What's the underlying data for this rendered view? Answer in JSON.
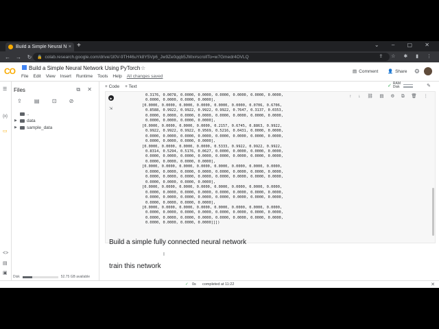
{
  "browser": {
    "tab_title": "Build a Simple Neural Ne",
    "tab_close": "×",
    "new_tab": "+",
    "url": "colab.research.google.com/drive/1l0V-9TH46uYk8Y5Vp6_Jw9Ze0qqb5JWx#scrollTo=w7Gmedr4OVLQ"
  },
  "colab": {
    "notebook_title": "Build a Simple Neural Network Using PyTorch",
    "menu": [
      "File",
      "Edit",
      "View",
      "Insert",
      "Runtime",
      "Tools",
      "Help"
    ],
    "saved_status": "All changes saved",
    "comment_label": "Comment",
    "share_label": "Share"
  },
  "files_panel": {
    "title": "Files",
    "tree": [
      {
        "name": "..",
        "expandable": false
      },
      {
        "name": "data",
        "expandable": true
      },
      {
        "name": "sample_data",
        "expandable": true
      }
    ],
    "disk_label": "Disk",
    "disk_available": "52.75 GB available",
    "disk_used_fraction": 0.28
  },
  "toolbar": {
    "add_code": "+ Code",
    "add_text": "+ Text",
    "ram_label": "RAM",
    "disk_label": "Disk"
  },
  "cell_output": [
    "0.3176, 0.0078, 0.0000, 0.0000, 0.0000, 0.0000, 0.0000, 0.0000,",
    "0.0000, 0.0000, 0.0000, 0.0000],",
    "[0.0000, 0.0000, 0.0000, 0.0000, 0.0000, 0.0000, 0.0706, 0.6706,",
    "0.8588, 0.9922, 0.9922, 0.9922, 0.9922, 0.7647, 0.3137, 0.0353,",
    "0.0000, 0.0000, 0.0000, 0.0000, 0.0000, 0.0000, 0.0000, 0.0000,",
    "0.0000, 0.0000, 0.0000, 0.0000],",
    "[0.0000, 0.0000, 0.0000, 0.0000, 0.2157, 0.6745, 0.8863, 0.9922,",
    "0.9922, 0.9922, 0.9922, 0.9569, 0.5216, 0.0431, 0.0000, 0.0000,",
    "0.0000, 0.0000, 0.0000, 0.0000, 0.0000, 0.0000, 0.0000, 0.0000,",
    "0.0000, 0.0000, 0.0000, 0.0000],",
    "[0.0000, 0.0000, 0.0000, 0.0000, 0.5333, 0.9922, 0.9922, 0.9922,",
    "0.8314, 0.5294, 0.5176, 0.0627, 0.0000, 0.0000, 0.0000, 0.0000,",
    "0.0000, 0.0000, 0.0000, 0.0000, 0.0000, 0.0000, 0.0000, 0.0000,",
    "0.0000, 0.0000, 0.0000, 0.0000],",
    "[0.0000, 0.0000, 0.0000, 0.0000, 0.0000, 0.0000, 0.0000, 0.0000,",
    "0.0000, 0.0000, 0.0000, 0.0000, 0.0000, 0.0000, 0.0000, 0.0000,",
    "0.0000, 0.0000, 0.0000, 0.0000, 0.0000, 0.0000, 0.0000, 0.0000,",
    "0.0000, 0.0000, 0.0000, 0.0000],",
    "[0.0000, 0.0000, 0.0000, 0.0000, 0.0000, 0.0000, 0.0000, 0.0000,",
    "0.0000, 0.0000, 0.0000, 0.0000, 0.0000, 0.0000, 0.0000, 0.0000,",
    "0.0000, 0.0000, 0.0000, 0.0000, 0.0000, 0.0000, 0.0000, 0.0000,",
    "0.0000, 0.0000, 0.0000, 0.0000],",
    "[0.0000, 0.0000, 0.0000, 0.0000, 0.0000, 0.0000, 0.0000, 0.0000,",
    "0.0000, 0.0000, 0.0000, 0.0000, 0.0000, 0.0000, 0.0000, 0.0000,",
    "0.0000, 0.0000, 0.0000, 0.0000, 0.0000, 0.0000, 0.0000, 0.0000,",
    "0.0000, 0.0000, 0.0000, 0.0000]]])"
  ],
  "markdown": {
    "heading1": "Build a simple fully connected neural network",
    "heading2": "train this network"
  },
  "status_bar": {
    "elapsed": "0s",
    "completed": "completed at 11:22"
  },
  "colors": {
    "accent": "#f9ab00",
    "chrome_dark": "#202124",
    "success": "#34a853"
  }
}
